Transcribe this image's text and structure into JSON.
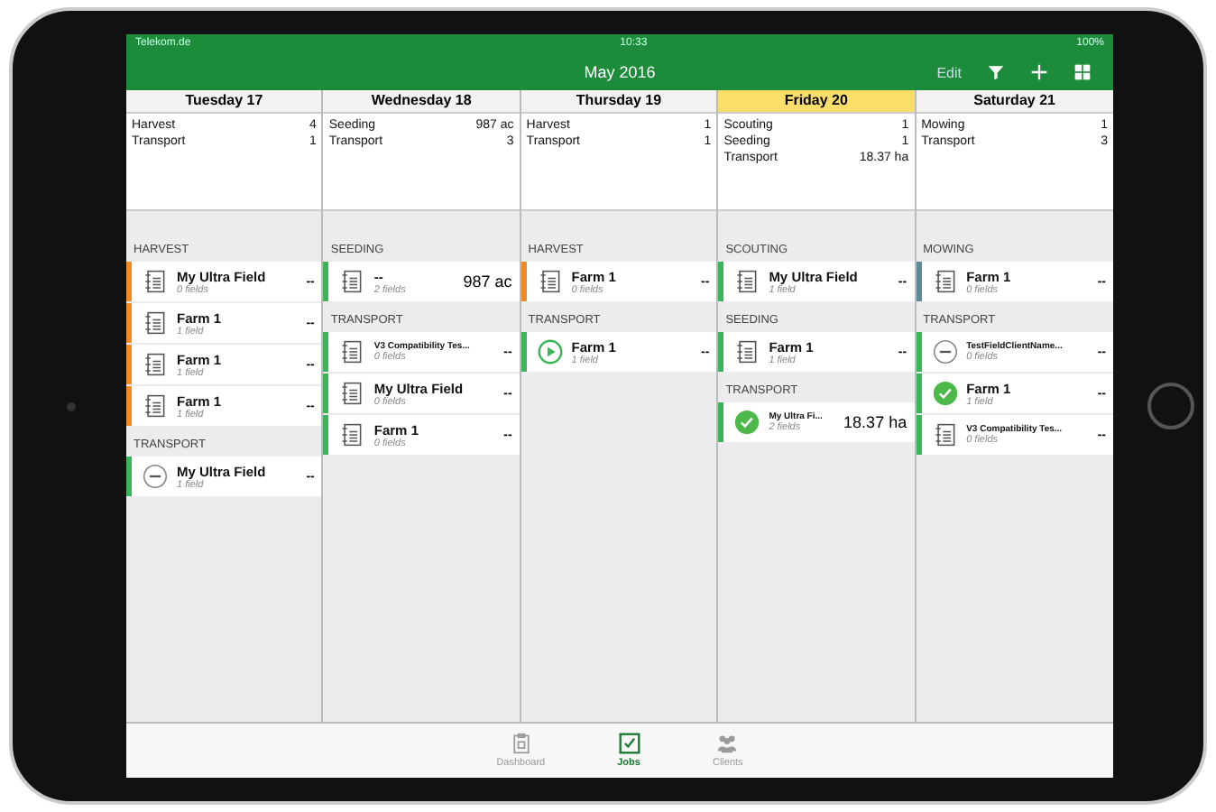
{
  "status_bar": {
    "carrier": "Telekom.de",
    "time": "10:33",
    "battery": "100%"
  },
  "nav_bar": {
    "title": "May 2016",
    "edit": "Edit"
  },
  "days": [
    {
      "title": "Tuesday 17",
      "selected": false,
      "summary": [
        {
          "label": "Harvest",
          "value": "4"
        },
        {
          "label": "Transport",
          "value": "1"
        }
      ],
      "groups": [
        {
          "title": "HARVEST",
          "jobs": [
            {
              "kind": "notes",
              "name": "My Ultra Field",
              "fields": "0 fields",
              "value": "--",
              "color": "#f08a24"
            },
            {
              "kind": "notes",
              "name": "Farm 1",
              "fields": "1 field",
              "value": "--",
              "color": "#f08a24"
            },
            {
              "kind": "notes",
              "name": "Farm 1",
              "fields": "1 field",
              "value": "--",
              "color": "#f08a24"
            },
            {
              "kind": "notes",
              "name": "Farm 1",
              "fields": "1 field",
              "value": "--",
              "color": "#f08a24"
            }
          ]
        },
        {
          "title": "TRANSPORT",
          "jobs": [
            {
              "kind": "minus",
              "name": "My Ultra Field",
              "fields": "1 field",
              "value": "--",
              "color": "#3cb55a"
            }
          ]
        }
      ]
    },
    {
      "title": "Wednesday 18",
      "selected": false,
      "summary": [
        {
          "label": "Seeding",
          "value": "987 ac"
        },
        {
          "label": "Transport",
          "value": "3"
        }
      ],
      "groups": [
        {
          "title": "SEEDING",
          "jobs": [
            {
              "kind": "notes",
              "name": "--",
              "fields": "2 fields",
              "value": "987 ac",
              "color": "#3cb55a"
            }
          ]
        },
        {
          "title": "TRANSPORT",
          "jobs": [
            {
              "kind": "notes",
              "name": "V3 Compatibility Tes...",
              "fields": "0 fields",
              "value": "--",
              "color": "#3cb55a"
            },
            {
              "kind": "notes",
              "name": "My Ultra Field",
              "fields": "0 fields",
              "value": "--",
              "color": "#3cb55a"
            },
            {
              "kind": "notes",
              "name": "Farm 1",
              "fields": "0 fields",
              "value": "--",
              "color": "#3cb55a"
            }
          ]
        }
      ]
    },
    {
      "title": "Thursday 19",
      "selected": false,
      "summary": [
        {
          "label": "Harvest",
          "value": "1"
        },
        {
          "label": "Transport",
          "value": "1"
        }
      ],
      "groups": [
        {
          "title": "HARVEST",
          "jobs": [
            {
              "kind": "notes",
              "name": "Farm 1",
              "fields": "0 fields",
              "value": "--",
              "color": "#f08a24"
            }
          ]
        },
        {
          "title": "TRANSPORT",
          "jobs": [
            {
              "kind": "play",
              "name": "Farm 1",
              "fields": "1 field",
              "value": "--",
              "color": "#3cb55a"
            }
          ]
        }
      ]
    },
    {
      "title": "Friday 20",
      "selected": true,
      "summary": [
        {
          "label": "Scouting",
          "value": "1"
        },
        {
          "label": "Seeding",
          "value": "1"
        },
        {
          "label": "Transport",
          "value": "18.37 ha"
        }
      ],
      "groups": [
        {
          "title": "SCOUTING",
          "jobs": [
            {
              "kind": "notes",
              "name": "My Ultra Field",
              "fields": "1 field",
              "value": "--",
              "color": "#3cb55a"
            }
          ]
        },
        {
          "title": "SEEDING",
          "jobs": [
            {
              "kind": "notes",
              "name": "Farm 1",
              "fields": "1 field",
              "value": "--",
              "color": "#3cb55a"
            }
          ]
        },
        {
          "title": "TRANSPORT",
          "jobs": [
            {
              "kind": "check",
              "name": "My Ultra Fi...",
              "fields": "2 fields",
              "value": "18.37 ha",
              "color": "#3cb55a"
            }
          ]
        }
      ]
    },
    {
      "title": "Saturday 21",
      "selected": false,
      "summary": [
        {
          "label": "Mowing",
          "value": "1"
        },
        {
          "label": "Transport",
          "value": "3"
        }
      ],
      "groups": [
        {
          "title": "MOWING",
          "jobs": [
            {
              "kind": "notes",
              "name": "Farm 1",
              "fields": "0 fields",
              "value": "--",
              "color": "#5f8a9a"
            }
          ]
        },
        {
          "title": "TRANSPORT",
          "jobs": [
            {
              "kind": "minus",
              "name": "TestFieldClientName...",
              "fields": "0 fields",
              "value": "--",
              "color": "#3cb55a"
            },
            {
              "kind": "check",
              "name": "Farm 1",
              "fields": "1 field",
              "value": "--",
              "color": "#3cb55a"
            },
            {
              "kind": "notes",
              "name": "V3 Compatibility Tes...",
              "fields": "0 fields",
              "value": "--",
              "color": "#3cb55a"
            }
          ]
        }
      ]
    }
  ],
  "tab_bar": [
    {
      "label": "Dashboard",
      "kind": "clipboard",
      "selected": false
    },
    {
      "label": "Jobs",
      "kind": "checkbox",
      "selected": true
    },
    {
      "label": "Clients",
      "kind": "people",
      "selected": false
    }
  ]
}
